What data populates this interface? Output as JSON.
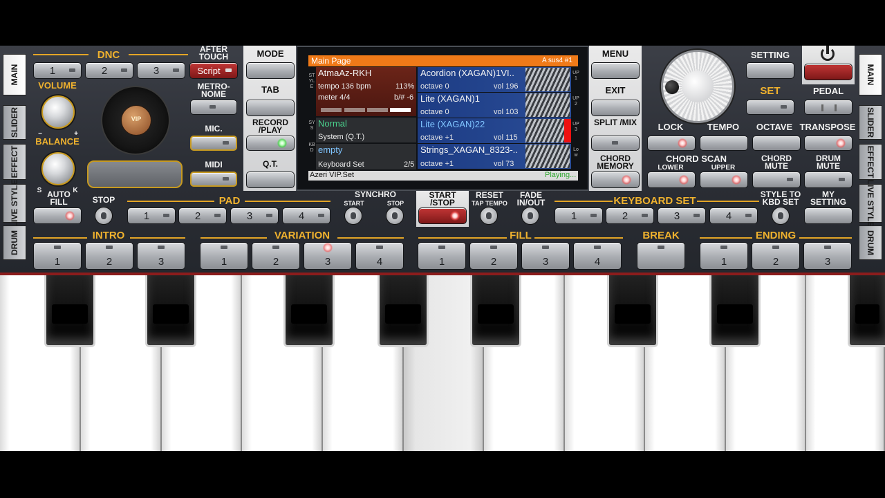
{
  "side_tabs_left": [
    "MAIN",
    "SLIDER",
    "EFFECT",
    "LIVE STYLE",
    "DRUM"
  ],
  "side_tabs_right": [
    "MAIN",
    "SLIDER",
    "EFFECT",
    "LIVE STYLE",
    "DRUM"
  ],
  "dnc": {
    "title": "DNC",
    "buttons": [
      "1",
      "2",
      "3"
    ],
    "after_touch": "AFTER TOUCH",
    "script": "Script"
  },
  "volume": "VOLUME",
  "balance": "BALANCE",
  "balance_minus": "−",
  "balance_plus": "+",
  "balance_s": "S",
  "balance_k": "K",
  "metronome": "METRO-NOME",
  "mic": "MIC.",
  "midi": "MIDI",
  "vip_logo": "VIP",
  "center_left": {
    "mode": "MODE",
    "tab": "TAB",
    "record_play": "RECORD /PLAY",
    "qt": "Q.T."
  },
  "center_right": {
    "menu": "MENU",
    "exit": "EXIT",
    "split_mix": "SPLIT /MIX",
    "chord_memory": "CHORD MEMORY"
  },
  "screen": {
    "header_left": "Main Page",
    "header_right": "A sus4 #1",
    "side_style": "STYLE",
    "side_sys": "SYS",
    "side_kbd": "KBD",
    "style_name": "AtmaAz-RKH",
    "tempo": "tempo 136 bpm",
    "tempo_pct": "113%",
    "meter": "meter 4/4",
    "bsharp": "b/# -6",
    "sys_name": "Normal",
    "sys_sub": "System (Q.T.)",
    "kbd_name": "empty",
    "kbd_sub": "Keyboard Set",
    "kbd_count": "2/5",
    "voices": [
      {
        "name": "Acordion (XAGAN)1VI..",
        "octave": "octave  0",
        "vol": "vol 196",
        "tag": "UP1"
      },
      {
        "name": "Lite (XAGAN)1",
        "octave": "octave  0",
        "vol": "vol 103",
        "tag": "UP2"
      },
      {
        "name": "Lite (XAGAN)22",
        "octave": "octave +1",
        "vol": "vol 115",
        "tag": "UP3"
      },
      {
        "name": "Strings_XAGAN_8323-..",
        "octave": "octave +1",
        "vol": "vol 73",
        "tag": "Low"
      }
    ],
    "footer_left": "Azeri VIP.Set",
    "footer_right": "Playing..."
  },
  "right": {
    "setting": "SETTING",
    "set": "SET",
    "pedal": "PEDAL",
    "lock": "LOCK",
    "tempo": "TEMPO",
    "octave": "OCTAVE",
    "transpose": "TRANSPOSE",
    "chord_scan": "CHORD SCAN",
    "lower": "LOWER",
    "upper": "UPPER",
    "chord_mute": "CHORD MUTE",
    "drum_mute": "DRUM MUTE"
  },
  "row3": {
    "auto_fill": "AUTO FILL",
    "stop": "STOP",
    "pad": "PAD",
    "pad_buttons": [
      "1",
      "2",
      "3",
      "4"
    ],
    "synchro": "SYNCHRO",
    "synchro_start": "START",
    "synchro_stop": "STOP",
    "start_stop": "START /STOP",
    "reset": "RESET",
    "tap_tempo": "TAP TEMPO",
    "fade": "FADE IN/OUT",
    "keyboard_set": "KEYBOARD SET",
    "kbd_buttons": [
      "1",
      "2",
      "3",
      "4"
    ],
    "style_to_kbd": "STYLE TO KBD SET",
    "my_setting": "MY SETTING"
  },
  "row4": {
    "intro": "INTRO",
    "intro_buttons": [
      "1",
      "2",
      "3"
    ],
    "variation": "VARIATION",
    "variation_buttons": [
      "1",
      "2",
      "3",
      "4"
    ],
    "fill": "FILL",
    "fill_buttons": [
      "1",
      "2",
      "3",
      "4"
    ],
    "break": "BREAK",
    "ending": "ENDING",
    "ending_buttons": [
      "1",
      "2",
      "3"
    ]
  },
  "colors": {
    "gold": "#f0b22e",
    "panel": "#30333a",
    "screen_header": "#f07a18",
    "style_row": "#5a1f18",
    "voice_row": "#1e3a78",
    "sys_text": "#49d08c",
    "kbd_text": "#7fc4ff",
    "playing": "#4bd24b"
  }
}
